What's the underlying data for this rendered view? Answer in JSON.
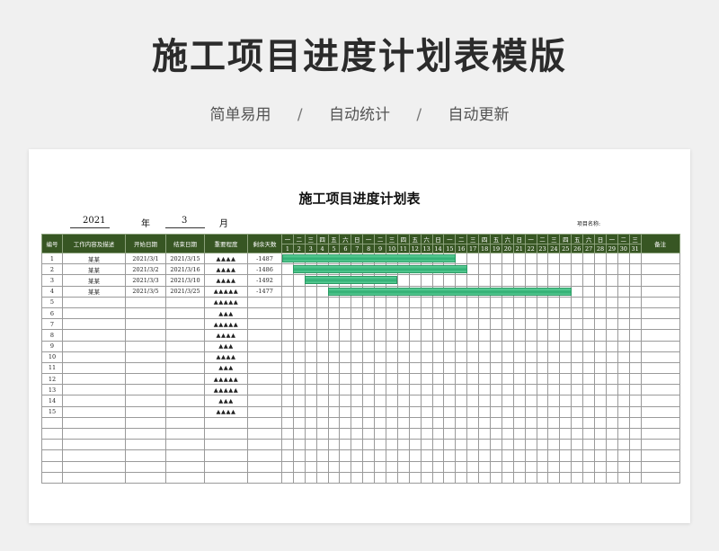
{
  "banner": {
    "title": "施工项目进度计划表模版",
    "features": [
      "简单易用",
      "自动统计",
      "自动更新"
    ],
    "separator": "/"
  },
  "sheet": {
    "title": "施工项目进度计划表",
    "year_value": "2021",
    "year_label": "年",
    "month_value": "3",
    "month_label": "月",
    "project_label": "项目名称:"
  },
  "table": {
    "headers": {
      "index": "编号",
      "content": "工作内容及描述",
      "start": "开始日期",
      "end": "结束日期",
      "importance": "重要程度",
      "remaining": "剩余天数",
      "remark": "备注"
    },
    "weekdays": [
      "一",
      "二",
      "三",
      "四",
      "五",
      "六",
      "日",
      "一",
      "二",
      "三",
      "四",
      "五",
      "六",
      "日",
      "一",
      "二",
      "三",
      "四",
      "五",
      "六",
      "日",
      "一",
      "二",
      "三",
      "四",
      "五",
      "六",
      "日",
      "一",
      "二",
      "三"
    ],
    "days": [
      "1",
      "2",
      "3",
      "4",
      "5",
      "6",
      "7",
      "8",
      "9",
      "10",
      "11",
      "12",
      "13",
      "14",
      "15",
      "16",
      "17",
      "18",
      "19",
      "20",
      "21",
      "22",
      "23",
      "24",
      "25",
      "26",
      "27",
      "28",
      "29",
      "30",
      "31"
    ],
    "rows": [
      {
        "no": "1",
        "content": "某某",
        "start": "2021/3/1",
        "end": "2021/3/15",
        "importance": "▲▲▲▲",
        "remaining": "-1487",
        "bar_start_day": 1,
        "bar_end_day": 15
      },
      {
        "no": "2",
        "content": "某某",
        "start": "2021/3/2",
        "end": "2021/3/16",
        "importance": "▲▲▲▲",
        "remaining": "-1486",
        "bar_start_day": 2,
        "bar_end_day": 16
      },
      {
        "no": "3",
        "content": "某某",
        "start": "2021/3/3",
        "end": "2021/3/10",
        "importance": "▲▲▲▲",
        "remaining": "-1492",
        "bar_start_day": 3,
        "bar_end_day": 10
      },
      {
        "no": "4",
        "content": "某某",
        "start": "2021/3/5",
        "end": "2021/3/25",
        "importance": "▲▲▲▲▲",
        "remaining": "-1477",
        "bar_start_day": 5,
        "bar_end_day": 25
      },
      {
        "no": "5",
        "content": "",
        "start": "",
        "end": "",
        "importance": "▲▲▲▲▲",
        "remaining": ""
      },
      {
        "no": "6",
        "content": "",
        "start": "",
        "end": "",
        "importance": "▲▲▲",
        "remaining": ""
      },
      {
        "no": "7",
        "content": "",
        "start": "",
        "end": "",
        "importance": "▲▲▲▲▲",
        "remaining": ""
      },
      {
        "no": "8",
        "content": "",
        "start": "",
        "end": "",
        "importance": "▲▲▲▲",
        "remaining": ""
      },
      {
        "no": "9",
        "content": "",
        "start": "",
        "end": "",
        "importance": "▲▲▲",
        "remaining": ""
      },
      {
        "no": "10",
        "content": "",
        "start": "",
        "end": "",
        "importance": "▲▲▲▲",
        "remaining": ""
      },
      {
        "no": "11",
        "content": "",
        "start": "",
        "end": "",
        "importance": "▲▲▲",
        "remaining": ""
      },
      {
        "no": "12",
        "content": "",
        "start": "",
        "end": "",
        "importance": "▲▲▲▲▲",
        "remaining": ""
      },
      {
        "no": "13",
        "content": "",
        "start": "",
        "end": "",
        "importance": "▲▲▲▲▲",
        "remaining": ""
      },
      {
        "no": "14",
        "content": "",
        "start": "",
        "end": "",
        "importance": "▲▲▲",
        "remaining": ""
      },
      {
        "no": "15",
        "content": "",
        "start": "",
        "end": "",
        "importance": "▲▲▲▲",
        "remaining": ""
      }
    ],
    "empty_rows": 6
  },
  "colors": {
    "header_bg": "#375623",
    "bar": "#3cbf80",
    "stars": "#e08d9b"
  }
}
